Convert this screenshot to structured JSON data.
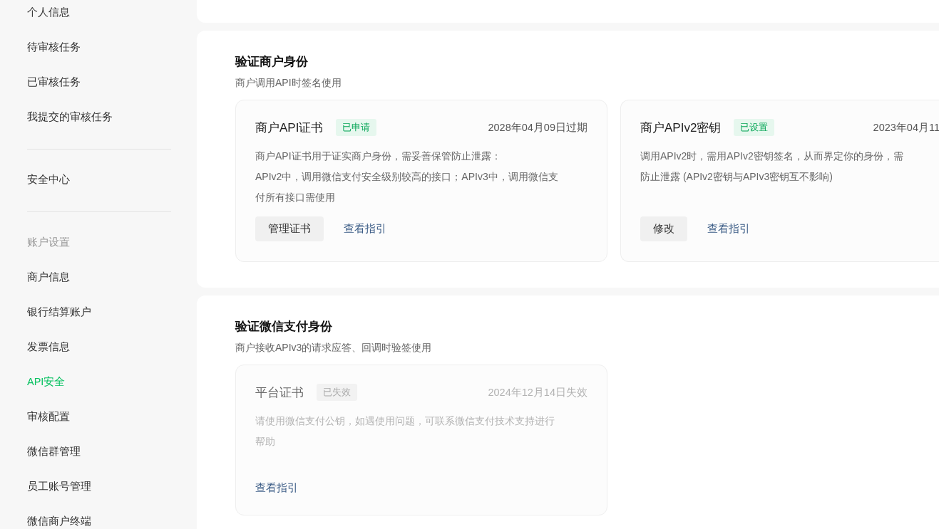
{
  "sidebar": {
    "groups": [
      {
        "items": [
          {
            "label": "个人信息",
            "selected": false
          },
          {
            "label": "待审核任务",
            "selected": false
          },
          {
            "label": "已审核任务",
            "selected": false
          },
          {
            "label": "我提交的审核任务",
            "selected": false
          }
        ]
      },
      {
        "items": [
          {
            "label": "安全中心",
            "selected": false
          }
        ]
      },
      {
        "heading": "账户设置",
        "items": [
          {
            "label": "商户信息",
            "selected": false
          },
          {
            "label": "银行结算账户",
            "selected": false
          },
          {
            "label": "发票信息",
            "selected": false
          },
          {
            "label": "API安全",
            "selected": true
          },
          {
            "label": "审核配置",
            "selected": false
          },
          {
            "label": "微信群管理",
            "selected": false
          },
          {
            "label": "员工账号管理",
            "selected": false
          },
          {
            "label": "微信商户终端",
            "selected": false
          }
        ]
      }
    ]
  },
  "sections": [
    {
      "title": "验证商户身份",
      "subtitle": "商户调用API时签名使用",
      "cards": [
        {
          "title": "商户API证书",
          "badge": {
            "label": "已申请",
            "expired": false
          },
          "date": "2028年04月09日过期",
          "disabled": false,
          "description": [
            "商户API证书用于证实商户身份，需妥善保管防止泄露：",
            "APIv2中，调用微信支付安全级别较高的接口；APIv3中，调用微信支",
            "付所有接口需使用"
          ],
          "actions": [
            {
              "label": "管理证书",
              "kind": "button"
            },
            {
              "label": "查看指引",
              "kind": "link"
            }
          ]
        },
        {
          "title": "商户APIv2密钥",
          "badge": {
            "label": "已设置",
            "expired": false
          },
          "date": "2023年04月11",
          "disabled": false,
          "description": [
            "调用APIv2时，需用APIv2密钥签名，从而界定你的身份，需",
            "防止泄露 (APIv2密钥与APIv3密钥互不影响)"
          ],
          "actions": [
            {
              "label": "修改",
              "kind": "button"
            },
            {
              "label": "查看指引",
              "kind": "link"
            }
          ]
        }
      ]
    },
    {
      "title": "验证微信支付身份",
      "subtitle": "商户接收APIv3的请求应答、回调时验签使用",
      "cards": [
        {
          "title": "平台证书",
          "badge": {
            "label": "已失效",
            "expired": true
          },
          "date": "2024年12月14日失效",
          "disabled": true,
          "description": [
            "请使用微信支付公钥，如遇使用问题，可联系微信支付技术支持进行",
            "帮助"
          ],
          "actions": [
            {
              "label": "查看指引",
              "kind": "link"
            }
          ]
        }
      ]
    }
  ]
}
